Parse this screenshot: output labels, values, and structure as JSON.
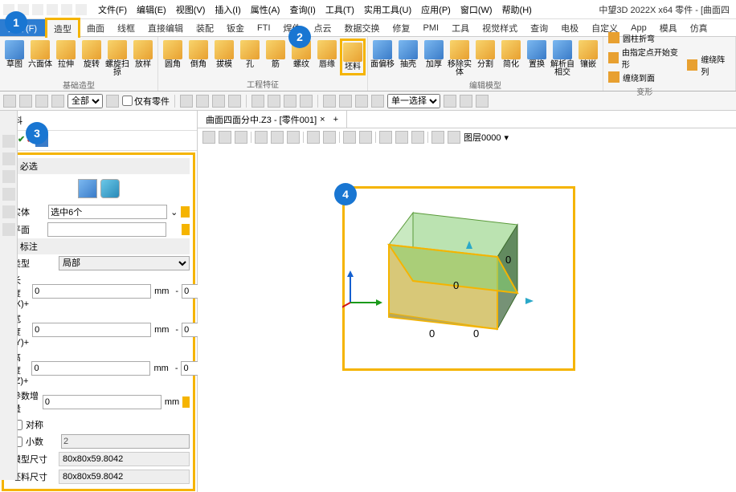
{
  "app": {
    "title_right": "中望3D 2022X x64     零件 - [曲面四"
  },
  "menus": [
    "文件(F)",
    "编辑(E)",
    "视图(V)",
    "插入(I)",
    "属性(A)",
    "查询(I)",
    "工具(T)",
    "实用工具(U)",
    "应用(P)",
    "窗口(W)",
    "帮助(H)"
  ],
  "ribbon": {
    "file": "文件(F)",
    "tabs": [
      "造型",
      "曲面",
      "线框",
      "直接编辑",
      "装配",
      "钣金",
      "FTI",
      "焊件",
      "点云",
      "数据交换",
      "修复",
      "PMI",
      "工具",
      "视觉样式",
      "查询",
      "电极",
      "自定义",
      "App",
      "模具",
      "仿真"
    ],
    "active_tab": "造型",
    "groups": [
      {
        "label": "基础造型",
        "buttons": [
          "草图",
          "六面体",
          "拉伸",
          "旋转",
          "螺旋扫掠",
          "放样"
        ]
      },
      {
        "label": "工程特征",
        "buttons": [
          "圆角",
          "倒角",
          "拔模",
          "孔",
          "筋",
          "螺纹",
          "唇缘",
          "坯料"
        ]
      },
      {
        "label": "编辑模型",
        "buttons": [
          "面偏移",
          "抽壳",
          "加厚",
          "移除实体",
          "分割",
          "简化",
          "置换",
          "解析自相交",
          "镶嵌"
        ]
      },
      {
        "label": "变形",
        "small": [
          "圆柱折弯",
          "由指定点开始变形",
          "缠绕到面"
        ],
        "extra": "缠绕阵列"
      }
    ]
  },
  "subbar": {
    "filter": "全部",
    "only_parts": "仅有零件",
    "select_mode": "单一选择"
  },
  "panel": {
    "title": "坯料",
    "required": "必选",
    "entity_lbl": "实体",
    "entity_val": "选中6个",
    "plane_lbl": "平面",
    "annot": "标注",
    "type_lbl": "类型",
    "type_val": "局部",
    "lenx": "长度(X)+",
    "leny": "宽度(Y)+",
    "lenz": "高度(Z)+",
    "param_inc": "参数增量",
    "zero": "0",
    "two": "2",
    "mm": "mm",
    "sym": "对称",
    "dec": "小数",
    "model_size_lbl": "模型尺寸",
    "model_size_val": "80x80x59.8042",
    "stock_size_lbl": "坯料尺寸",
    "stock_size_val": "80x80x59.8042"
  },
  "doc": {
    "tab": "曲面四面分中.Z3 - [零件001]"
  },
  "vtoolbar": {
    "layer_lbl": "图层0000"
  },
  "canvas": {
    "vals": [
      "0",
      "0",
      "0",
      "0"
    ]
  },
  "callouts": [
    "1",
    "2",
    "3",
    "4"
  ]
}
